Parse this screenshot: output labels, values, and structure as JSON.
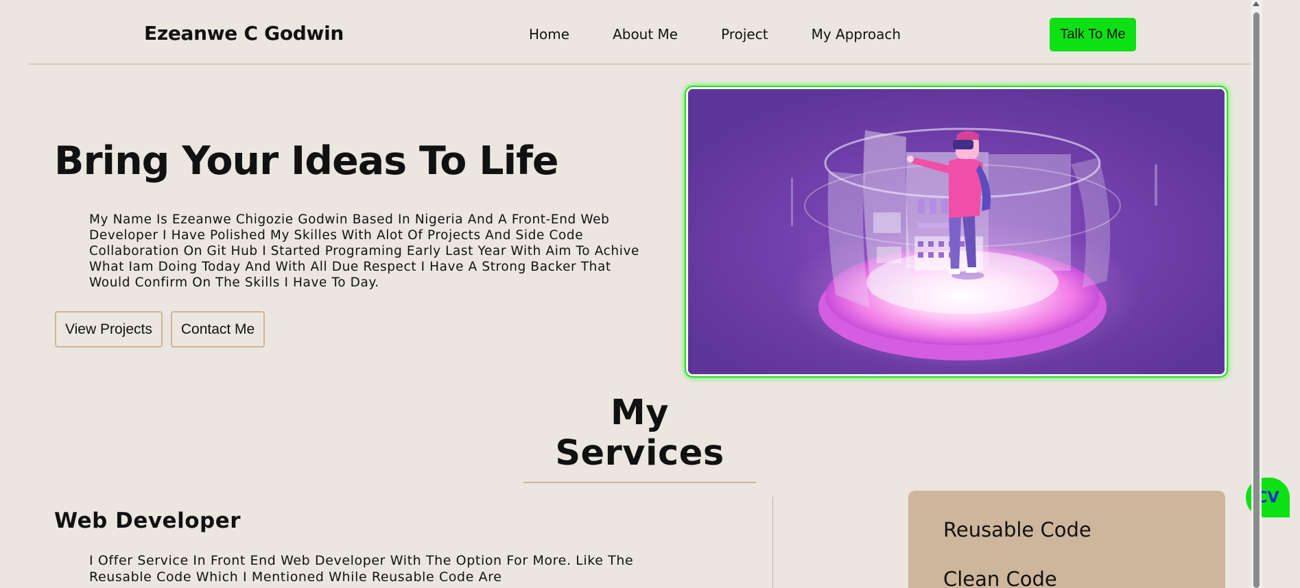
{
  "header": {
    "logo": "Ezeanwe C Godwin",
    "nav": [
      "Home",
      "About Me",
      "Project",
      "My Approach"
    ],
    "cta_label": "Talk To Me"
  },
  "hero": {
    "title": "Bring Your Ideas To Life",
    "description": "My Name Is Ezeanwe Chigozie Godwin Based In Nigeria And A Front-End Web Developer I Have Polished My Skilles With Alot Of Projects And Side Code Collaboration On Git Hub I Started Programing Early Last Year With Aim To Achive What Iam Doing Today And With All Due Respect I Have A Strong Backer That Would Confirm On The Skills I Have To Day.",
    "buttons": {
      "view_projects": "View Projects",
      "contact_me": "Contact Me"
    },
    "image_icon": "vr-hologram-illustration"
  },
  "services": {
    "title": "My Services",
    "heading": "Web Developer",
    "text": "I Offer Service In Front End Web Developer With The Option For More. Like The Reusable Code Which I Mentioned While Reusable Code Are",
    "card_items": [
      "Reusable Code",
      "Clean Code"
    ]
  },
  "cv_badge": "CV",
  "colors": {
    "background": "#ebe6e0",
    "accent_green": "#0de013",
    "card_tan": "#cdb69b",
    "divider": "#c9b59c",
    "cv_text": "#1b2bd6"
  }
}
